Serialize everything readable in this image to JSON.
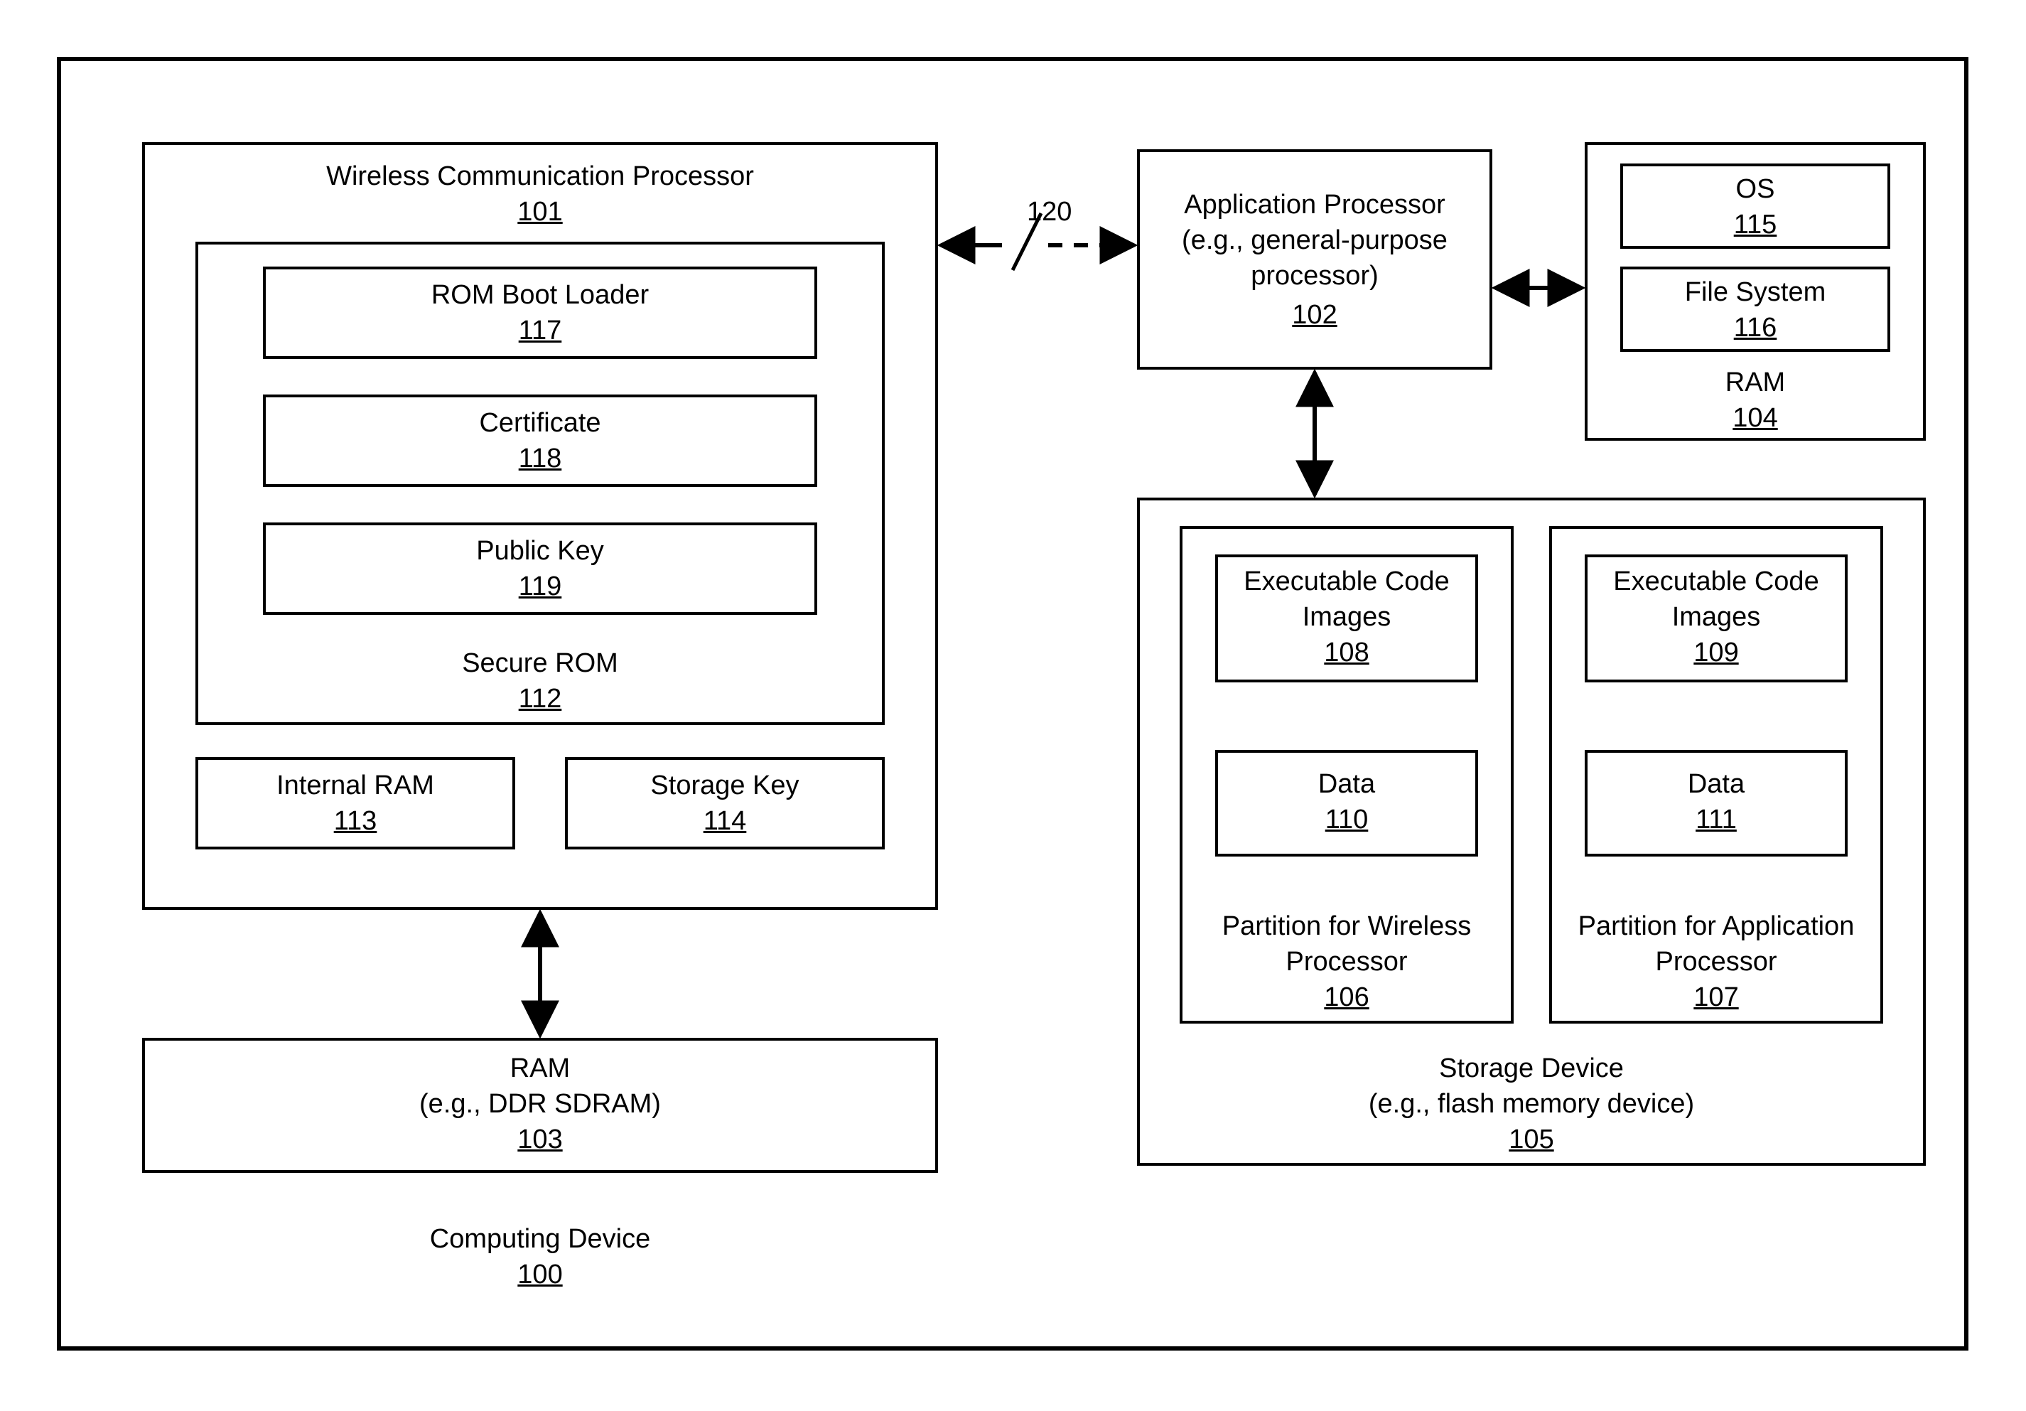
{
  "diagram": {
    "outer": {
      "title": "Computing Device",
      "ref": "100"
    },
    "wcp": {
      "title": "Wireless Communication Processor",
      "ref": "101",
      "secureRom": {
        "title": "Secure ROM",
        "ref": "112",
        "bootLoader": {
          "title": "ROM Boot Loader",
          "ref": "117"
        },
        "certificate": {
          "title": "Certificate",
          "ref": "118"
        },
        "publicKey": {
          "title": "Public Key",
          "ref": "119"
        }
      },
      "internalRam": {
        "title": "Internal RAM",
        "ref": "113"
      },
      "storageKey": {
        "title": "Storage Key",
        "ref": "114"
      }
    },
    "ram103": {
      "line1": "RAM",
      "line2": "(e.g., DDR SDRAM)",
      "ref": "103"
    },
    "appProc": {
      "line1": "Application Processor",
      "line2": "(e.g., general-purpose",
      "line3": "processor)",
      "ref": "102"
    },
    "ram104": {
      "title": "RAM",
      "ref": "104",
      "os": {
        "title": "OS",
        "ref": "115"
      },
      "fs": {
        "title": "File System",
        "ref": "116"
      }
    },
    "storage": {
      "line1": "Storage Device",
      "line2": "(e.g., flash memory device)",
      "ref": "105",
      "partWireless": {
        "title": "Partition for Wireless Processor",
        "ref": "106",
        "exec": {
          "line1": "Executable Code",
          "line2": "Images",
          "ref": "108"
        },
        "data": {
          "title": "Data",
          "ref": "110"
        }
      },
      "partApp": {
        "title": "Partition for Application Processor",
        "ref": "107",
        "exec": {
          "line1": "Executable Code",
          "line2": "Images",
          "ref": "109"
        },
        "data": {
          "title": "Data",
          "ref": "111"
        }
      }
    },
    "link120": "120"
  }
}
